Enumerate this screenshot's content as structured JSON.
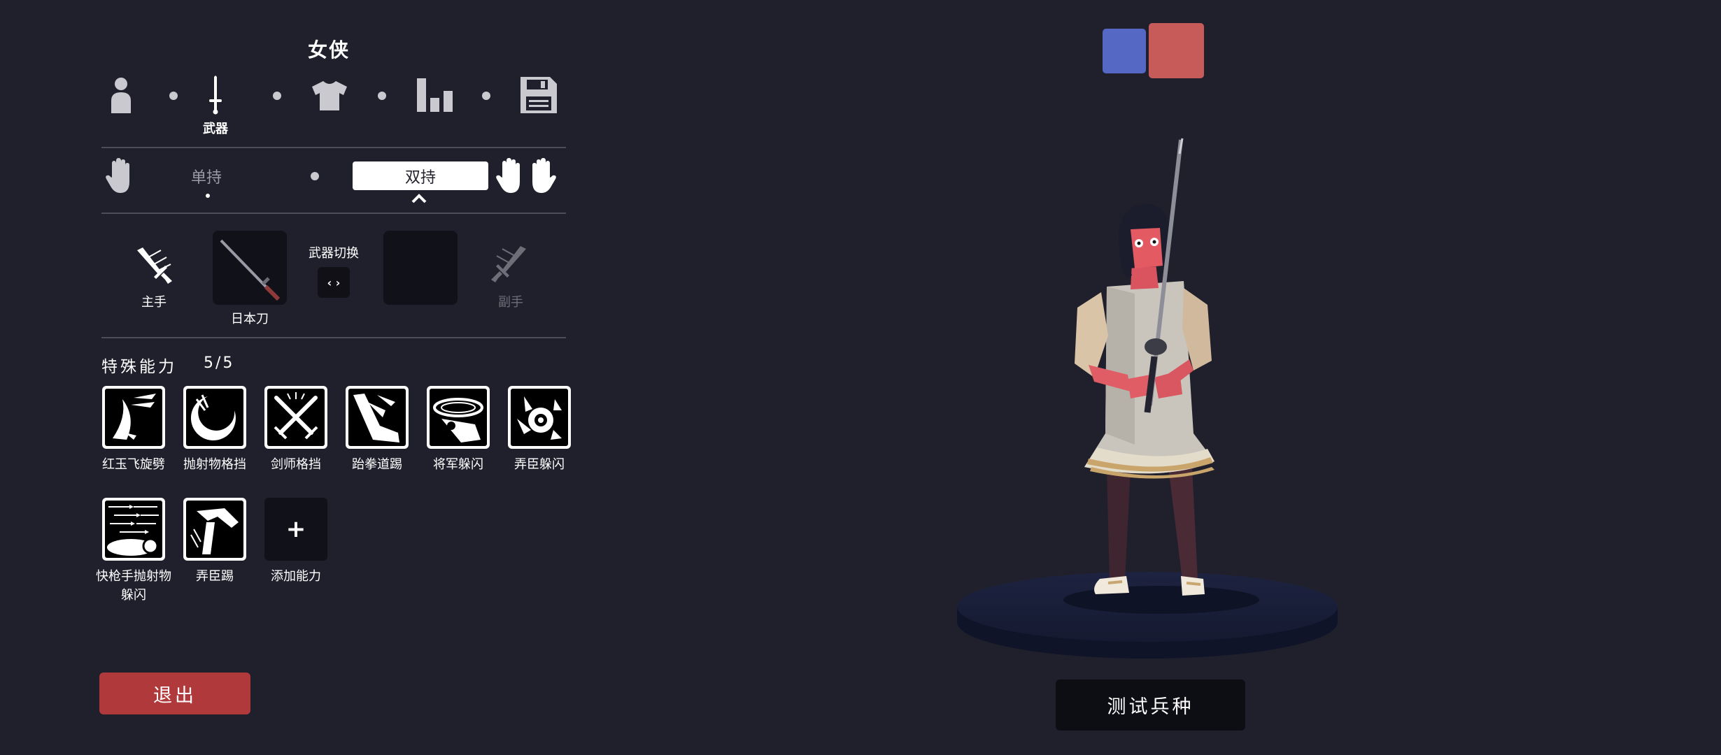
{
  "unit": {
    "title": "女侠"
  },
  "steps": [
    {
      "id": "body",
      "label": "",
      "icon": "person-icon"
    },
    {
      "id": "weapon",
      "label": "武器",
      "icon": "sword-icon",
      "active": true
    },
    {
      "id": "clothing",
      "label": "",
      "icon": "shirt-icon"
    },
    {
      "id": "stats",
      "label": "",
      "icon": "bar-chart-icon"
    },
    {
      "id": "save",
      "label": "",
      "icon": "floppy-disk-icon"
    }
  ],
  "grip": {
    "single_label": "单持",
    "dual_label": "双持",
    "selected": "dual"
  },
  "weapons": {
    "main_hand_label": "主手",
    "off_hand_label": "副手",
    "main_weapon_name": "日本刀",
    "switch_label": "武器切换",
    "switch_glyph": "‹ ›"
  },
  "abilities": {
    "title": "特殊能力",
    "count": "5/5",
    "items": [
      {
        "label": "红玉飞旋劈",
        "icon": "crescent-slash-icon"
      },
      {
        "label": "抛射物格挡",
        "icon": "projectile-block-icon"
      },
      {
        "label": "剑师格挡",
        "icon": "crossed-swords-icon"
      },
      {
        "label": "跆拳道踢",
        "icon": "kick-icon"
      },
      {
        "label": "将军躲闪",
        "icon": "general-dodge-icon"
      },
      {
        "label": "弄臣躲闪",
        "icon": "jester-dodge-icon"
      },
      {
        "label": "快枪手抛射物躲闪",
        "icon": "arrows-dodge-icon"
      },
      {
        "label": "弄臣踢",
        "icon": "jester-kick-icon"
      }
    ],
    "add_label": "添加能力",
    "add_glyph": "+"
  },
  "buttons": {
    "exit": "退出",
    "test_unit": "测试兵种"
  },
  "teams": {
    "blue": "#5468c4",
    "red": "#c75b5a"
  },
  "colors": {
    "background": "#20202d",
    "exit_button": "#b0393b",
    "slot_bg": "#111119"
  }
}
